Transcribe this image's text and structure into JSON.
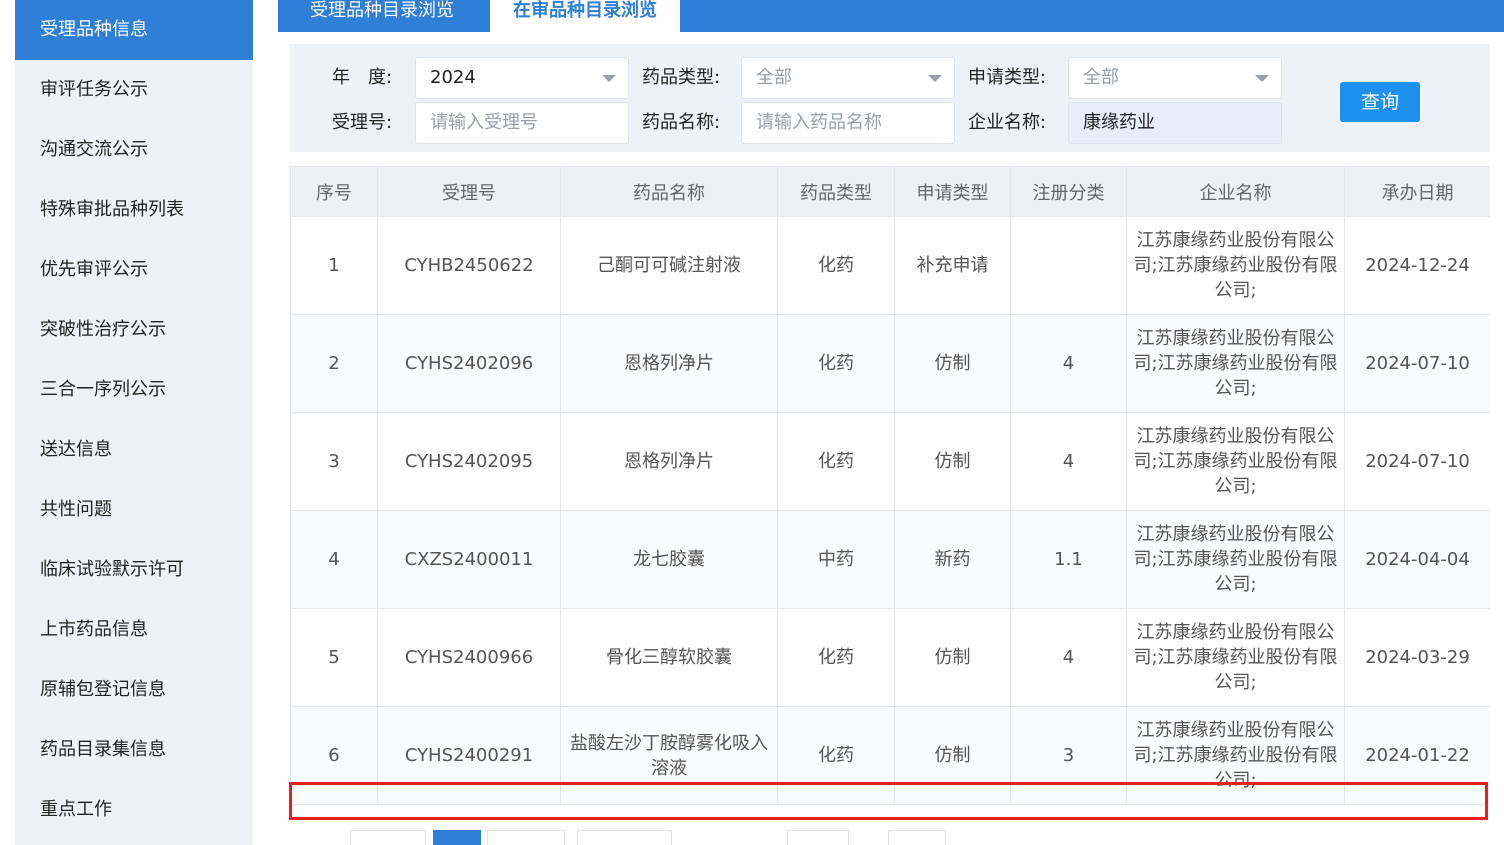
{
  "sidebar": {
    "items": [
      {
        "label": "受理品种信息",
        "active": true
      },
      {
        "label": "审评任务公示"
      },
      {
        "label": "沟通交流公示"
      },
      {
        "label": "特殊审批品种列表"
      },
      {
        "label": "优先审评公示"
      },
      {
        "label": "突破性治疗公示"
      },
      {
        "label": "三合一序列公示"
      },
      {
        "label": "送达信息"
      },
      {
        "label": "共性问题"
      },
      {
        "label": "临床试验默示许可"
      },
      {
        "label": "上市药品信息"
      },
      {
        "label": "原辅包登记信息"
      },
      {
        "label": "药品目录集信息"
      },
      {
        "label": "重点工作"
      }
    ]
  },
  "tabs": [
    {
      "label": "受理品种目录浏览"
    },
    {
      "label": "在审品种目录浏览",
      "active": true
    }
  ],
  "filter": {
    "year_label": "年　度:",
    "year_value": "2024",
    "drug_type_label": "药品类型:",
    "drug_type_value": "全部",
    "apply_type_label": "申请类型:",
    "apply_type_value": "全部",
    "accept_no_label": "受理号:",
    "accept_no_placeholder": "请输入受理号",
    "drug_name_label": "药品名称:",
    "drug_name_placeholder": "请输入药品名称",
    "company_label": "企业名称:",
    "company_value": "康缘药业",
    "query_button": "查询"
  },
  "table": {
    "headers": [
      "序号",
      "受理号",
      "药品名称",
      "药品类型",
      "申请类型",
      "注册分类",
      "企业名称",
      "承办日期"
    ],
    "rows": [
      [
        "1",
        "CYHB2450622",
        "己酮可可碱注射液",
        "化药",
        "补充申请",
        "",
        "江苏康缘药业股份有限公司;江苏康缘药业股份有限公司;",
        "2024-12-24"
      ],
      [
        "2",
        "CYHS2402096",
        "恩格列净片",
        "化药",
        "仿制",
        "4",
        "江苏康缘药业股份有限公司;江苏康缘药业股份有限公司;",
        "2024-07-10"
      ],
      [
        "3",
        "CYHS2402095",
        "恩格列净片",
        "化药",
        "仿制",
        "4",
        "江苏康缘药业股份有限公司;江苏康缘药业股份有限公司;",
        "2024-07-10"
      ],
      [
        "4",
        "CXZS2400011",
        "龙七胶囊",
        "中药",
        "新药",
        "1.1",
        "江苏康缘药业股份有限公司;江苏康缘药业股份有限公司;",
        "2024-04-04"
      ],
      [
        "5",
        "CYHS2400966",
        "骨化三醇软胶囊",
        "化药",
        "仿制",
        "4",
        "江苏康缘药业股份有限公司;江苏康缘药业股份有限公司;",
        "2024-03-29"
      ],
      [
        "6",
        "CYHS2400291",
        "盐酸左沙丁胺醇雾化吸入溶液",
        "化药",
        "仿制",
        "3",
        "江苏康缘药业股份有限公司;江苏康缘药业股份有限公司;",
        "2024-01-22"
      ]
    ]
  },
  "colors": {
    "brand": "#2f7fd6",
    "query_button": "#1e90f0",
    "highlight_box": "#e8211f"
  }
}
